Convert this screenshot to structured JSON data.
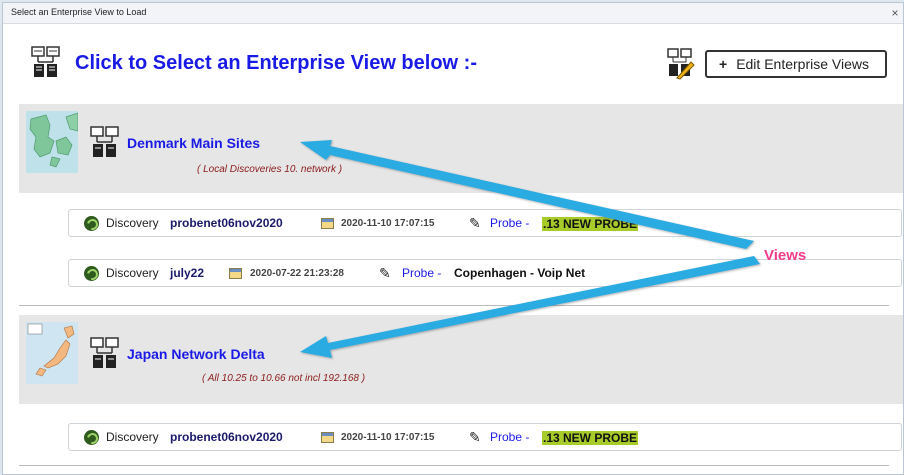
{
  "window": {
    "title": "Select an Enterprise View to Load",
    "close_symbol": "×"
  },
  "header": {
    "title": "Click to Select an Enterprise View below :-",
    "edit_button": "Edit Enterprise Views",
    "edit_plus": "+"
  },
  "views": [
    {
      "name": "Denmark Main Sites",
      "description": "( Local Discoveries 10. network )"
    },
    {
      "name": "Japan Network Delta",
      "description": "( All 10.25 to 10.66 not incl 192.168 )"
    }
  ],
  "discoveries": [
    {
      "label": "Discovery",
      "name": "probenet06nov2020",
      "timestamp": "2020-11-10 17:07:15",
      "probe_label": "Probe -",
      "probe": ".13 NEW PROBE",
      "highlight": true
    },
    {
      "label": "Discovery",
      "name": "july22",
      "timestamp": "2020-07-22 21:23:28",
      "probe_label": "Probe -",
      "probe": "Copenhagen - Voip Net",
      "highlight": false
    },
    {
      "label": "Discovery",
      "name": "probenet06nov2020",
      "timestamp": "2020-11-10 17:07:15",
      "probe_label": "Probe -",
      "probe": ".13 NEW PROBE",
      "highlight": true
    }
  ],
  "annotation": {
    "text": "Views",
    "color": "#f03c8a",
    "arrow_color": "#29abe2"
  },
  "colors": {
    "link_blue": "#1a1ae6",
    "view_bg": "#e6e6e6",
    "highlight": "#a7cc2a"
  }
}
